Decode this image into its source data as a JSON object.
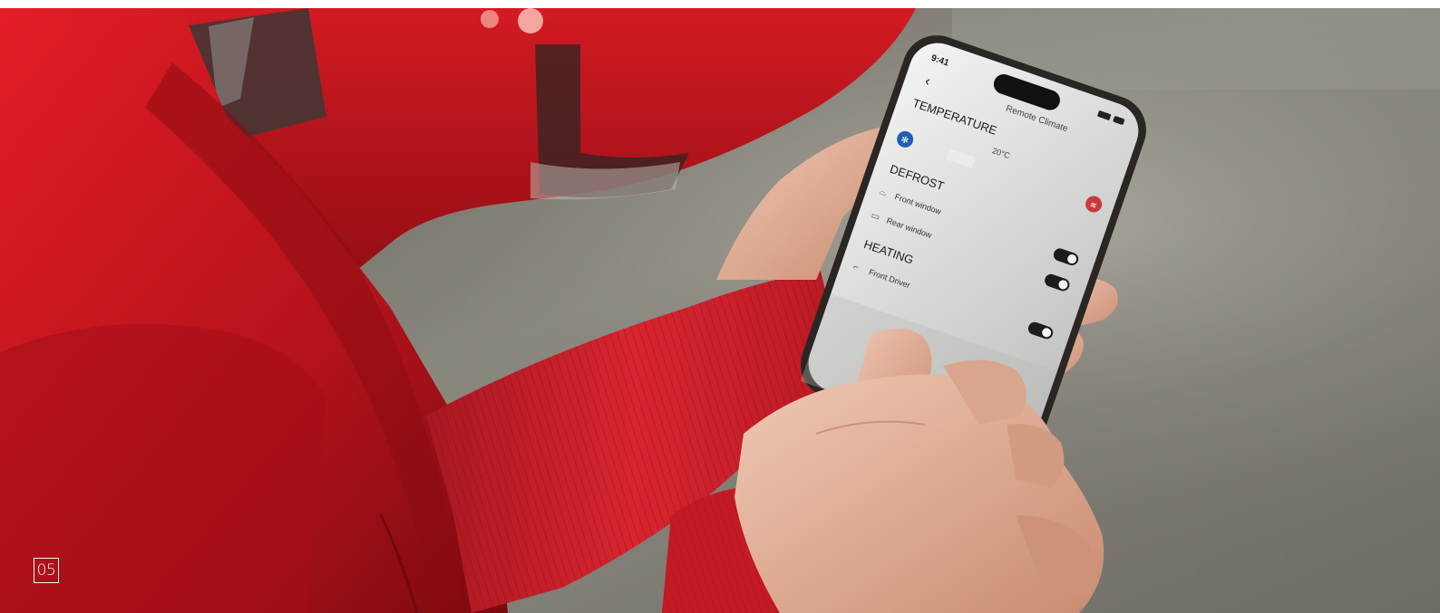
{
  "slide": {
    "number": "05"
  },
  "phone_screen": {
    "status_time": "9:41",
    "title": "Remote Climate",
    "temperature_heading": "TEMPERATURE",
    "temperature_value": "20°C",
    "defrost_heading": "DEFROST",
    "defrost_items": [
      "Front window",
      "Rear window"
    ],
    "heating_heading": "HEATING",
    "heating_items": [
      "Front Driver"
    ]
  },
  "colors": {
    "jacket_red": "#c8141e",
    "background_gray": "#8a8a84",
    "slider_cold": "#1f5fb5",
    "slider_hot": "#c93b3b",
    "screen_bg": "#e9e9e9"
  }
}
